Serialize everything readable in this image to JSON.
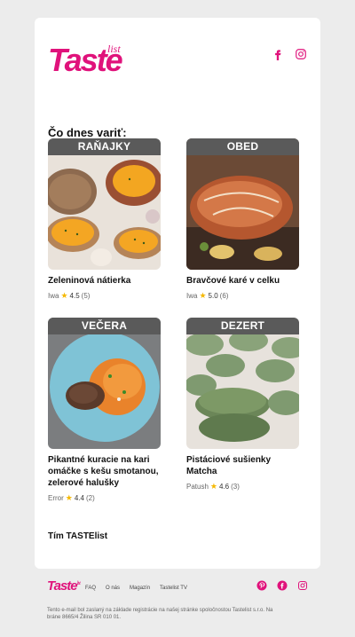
{
  "brand": {
    "logo_text": "Taste",
    "logo_sub": "list",
    "accent": "#e0127b"
  },
  "header": {
    "social": [
      {
        "icon": "facebook-icon"
      },
      {
        "icon": "instagram-icon"
      }
    ]
  },
  "main": {
    "heading": "Čo dnes variť:",
    "recipes": [
      {
        "tag": "RAŇAJKY",
        "title": "Zeleninová nátierka",
        "author": "Iwa",
        "rating": "4.5",
        "count": "(5)",
        "image": "spread-on-bread-image"
      },
      {
        "tag": "OBED",
        "title": "Bravčové karé v celku",
        "author": "Iwa",
        "rating": "5.0",
        "count": "(6)",
        "image": "roast-pork-image"
      },
      {
        "tag": "VEČERA",
        "title": "Pikantné kuracie na kari omáčke s kešu smotanou, zelerové halušky",
        "author": "Error",
        "rating": "4.4",
        "count": "(2)",
        "image": "curry-chicken-image"
      },
      {
        "tag": "DEZERT",
        "title": "Pistáciové sušienky Matcha",
        "author": "Patush",
        "rating": "4.6",
        "count": "(3)",
        "image": "matcha-cookies-image"
      }
    ],
    "signature": "Tím TASTElist"
  },
  "footer": {
    "logo_text": "Taste",
    "logo_sub": "list",
    "nav": [
      "FAQ",
      "O nás",
      "Magazín",
      "Tastelist TV"
    ],
    "social": [
      {
        "icon": "pinterest-icon"
      },
      {
        "icon": "facebook-icon"
      },
      {
        "icon": "instagram-icon"
      }
    ],
    "fine_print": "Tento e-mail bol zaslaný na základe registrácie na našej stránke spoločnostou Tastelist s.r.o. Na bráne 8665/4 Žilina SR 010 01."
  }
}
